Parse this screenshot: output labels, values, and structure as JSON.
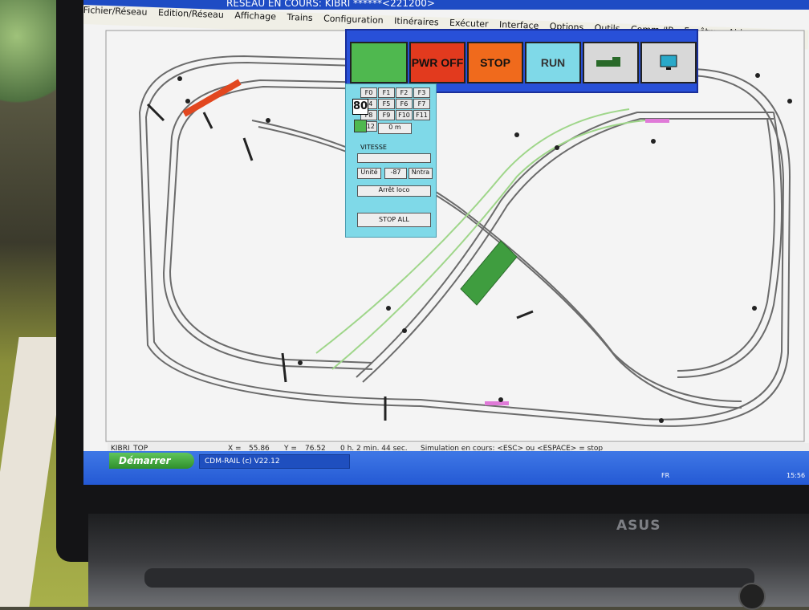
{
  "app": {
    "title": "RESEAU EN COURS: KIBRI ******<221200>",
    "menu": [
      "Fichier/Réseau",
      "Edition/Réseau",
      "Affichage",
      "Trains",
      "Configuration",
      "Itinéraires",
      "Exécuter",
      "Interface",
      "Options",
      "Outils",
      "Comm./IP",
      "Fenêtre",
      "Aide"
    ]
  },
  "toolbar": {
    "power_label": "PWR OFF",
    "stop_label": "STOP",
    "run_label": "RUN",
    "colors": {
      "green": "#4fb84f",
      "red": "#e23a1e",
      "orange": "#f06a1c",
      "cyan": "#7fd9e8"
    }
  },
  "loco_panel": {
    "speed_display": "80",
    "function_keys": [
      "F0",
      "F1",
      "F2",
      "F3",
      "F4",
      "F5",
      "F6",
      "F7",
      "F8",
      "F9",
      "F10",
      "F11",
      "F12"
    ],
    "distance": "0 m",
    "vitesse_label": "VITESSE",
    "unit_label": "Unité",
    "speed_value": "-87",
    "mode_label": "Nntra",
    "stop_loco_label": "Arrêt loco",
    "stop_all_label": "STOP ALL"
  },
  "status": {
    "layout_name": "KIBRI_TOP",
    "x_label": "X =",
    "x_value": "55.86",
    "y_label": "Y =",
    "y_value": "76.52",
    "elapsed": "0 h. 2 min. 44 sec.",
    "message": "Simulation en cours: <ESC> ou <ESPACE> = stop"
  },
  "taskbar": {
    "start_label": "Démarrer",
    "task_label": "CDM-RAIL (c) V22.12",
    "lang": "FR",
    "clock": "15:56"
  },
  "device": {
    "brand": "ASUS"
  }
}
